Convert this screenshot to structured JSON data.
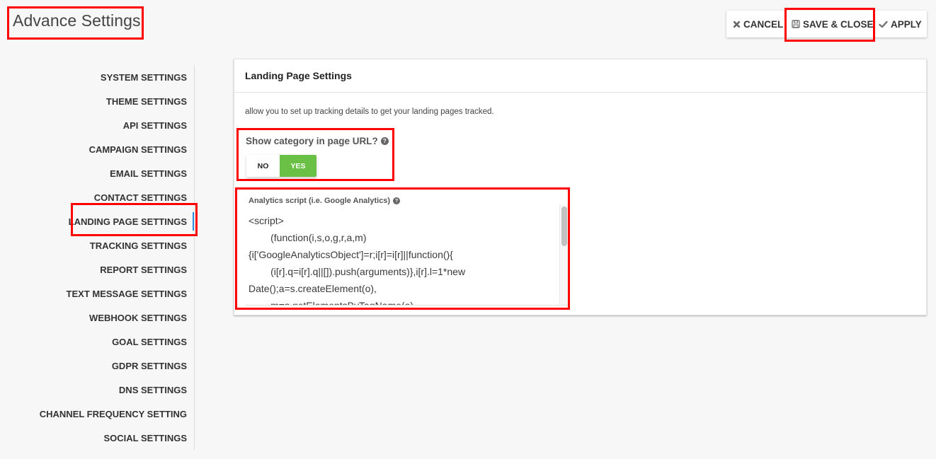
{
  "header": {
    "title": "Advance Settings"
  },
  "toolbar": {
    "cancel": {
      "label": "CANCEL",
      "icon": "close-icon"
    },
    "save_close": {
      "label": "SAVE & CLOSE",
      "icon": "floppy-disk-icon"
    },
    "apply": {
      "label": "APPLY",
      "icon": "check-icon"
    }
  },
  "sidebar": {
    "active_index": 6,
    "items": [
      {
        "label": "SYSTEM SETTINGS"
      },
      {
        "label": "THEME SETTINGS"
      },
      {
        "label": "API SETTINGS"
      },
      {
        "label": "CAMPAIGN SETTINGS"
      },
      {
        "label": "EMAIL SETTINGS"
      },
      {
        "label": "CONTACT SETTINGS"
      },
      {
        "label": "LANDING PAGE SETTINGS"
      },
      {
        "label": "TRACKING SETTINGS"
      },
      {
        "label": "REPORT SETTINGS"
      },
      {
        "label": "TEXT MESSAGE SETTINGS"
      },
      {
        "label": "WEBHOOK SETTINGS"
      },
      {
        "label": "GOAL SETTINGS"
      },
      {
        "label": "GDPR SETTINGS"
      },
      {
        "label": "DNS SETTINGS"
      },
      {
        "label": "CHANNEL FREQUENCY SETTING"
      },
      {
        "label": "SOCIAL SETTINGS"
      }
    ]
  },
  "panel": {
    "title": "Landing Page Settings",
    "description": "allow you to set up tracking details to get your landing pages tracked.",
    "show_category": {
      "label": "Show category in page URL?",
      "help_icon": "question-circle-icon",
      "options": {
        "no": "NO",
        "yes": "YES"
      },
      "selected": "YES"
    },
    "analytics_script": {
      "label": "Analytics script (i.e. Google Analytics)",
      "help_icon": "question-circle-icon",
      "value": "<script>\n        (function(i,s,o,g,r,a,m)\n{i['GoogleAnalyticsObject']=r;i[r]=i[r]||function(){\n        (i[r].q=i[r].q||[]).push(arguments)},i[r].l=1*new\nDate();a=s.createElement(o),\n        m=s.getElementsByTagName(o)"
    }
  },
  "colors": {
    "highlight": "#ff0000",
    "toggle_active": "#6abf45",
    "sidebar_active_indicator": "#2b8ce0"
  }
}
